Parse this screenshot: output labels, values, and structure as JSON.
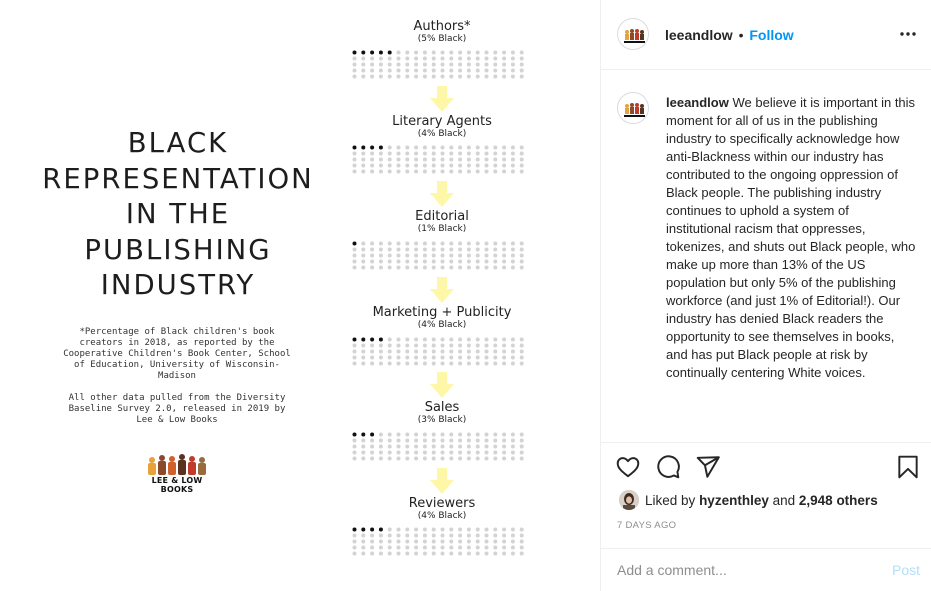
{
  "image": {
    "title_lines": [
      "BLACK",
      "REPRESENTATION",
      "IN THE",
      "PUBLISHING",
      "INDUSTRY"
    ],
    "footnote_1": "*Percentage of Black children's book creators in 2018, as reported by the Cooperative Children's Book Center, School of Education, University of Wisconsin-Madison",
    "footnote_2": "All other data pulled from the Diversity Baseline Survey 2.0, released in 2019 by Lee & Low Books",
    "logo_text": "LEE & LOW BOOKS",
    "stages": [
      {
        "name": "Authors*",
        "pct_label": "(5% Black)",
        "black_dots": 5
      },
      {
        "name": "Literary Agents",
        "pct_label": "(4% Black)",
        "black_dots": 4
      },
      {
        "name": "Editorial",
        "pct_label": "(1% Black)",
        "black_dots": 1
      },
      {
        "name": "Marketing + Publicity",
        "pct_label": "(4% Black)",
        "black_dots": 4
      },
      {
        "name": "Sales",
        "pct_label": "(3% Black)",
        "black_dots": 3
      },
      {
        "name": "Reviewers",
        "pct_label": "(4% Black)",
        "black_dots": 4
      }
    ],
    "colors": {
      "arrow": "#fff7a8",
      "dot_black": "#111111",
      "dot_grey": "#d3d3d3"
    }
  },
  "header": {
    "username": "leeandlow",
    "separator": "•",
    "follow_label": "Follow",
    "more_icon": "more-horizontal-icon"
  },
  "caption": {
    "username": "leeandlow",
    "text": "We believe it is important in this moment for all of us in the publishing industry to specifically acknowledge how anti-Blackness within our industry has contributed to the ongoing oppression of Black people. The publishing industry continues to uphold a system of institutional racism that oppresses, tokenizes, and shuts out Black people, who make up more than 13% of the US population but only 5% of the publishing workforce (and just 1% of Editorial!). Our industry has denied Black readers the opportunity to see themselves in books, and has put Black people at risk by continually centering White voices."
  },
  "actions": {
    "icons": [
      "heart-icon",
      "comment-icon",
      "share-icon",
      "bookmark-icon"
    ],
    "liked_by_prefix": "Liked by",
    "liked_by_user": "hyzenthley",
    "liked_by_and": "and",
    "liked_by_others": "2,948 others",
    "time_ago": "7 DAYS AGO"
  },
  "comment": {
    "placeholder": "Add a comment...",
    "post_label": "Post"
  }
}
